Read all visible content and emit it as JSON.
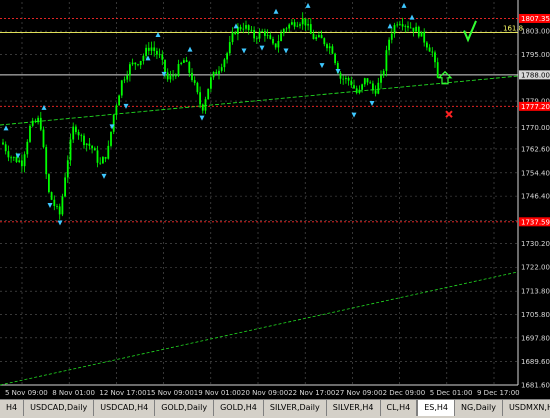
{
  "chart_data": {
    "type": "candlestick",
    "title": "",
    "x_labels": [
      "5 Nov 09:00",
      "8 Nov 01:00",
      "12 Nov 17:00",
      "15 Nov 09:00",
      "19 Nov 01:00",
      "20 Nov 09:00",
      "22 Nov 17:00",
      "27 Nov 09:00",
      "2 Dec 09:00",
      "5 Dec 01:00",
      "9 Dec 17:00"
    ],
    "y_ticks": [
      "1803.00",
      "1795.00",
      "1788.00",
      "1779.00",
      "1770.00",
      "1762.60",
      "1754.40",
      "1746.40",
      "1738.00",
      "1730.20",
      "1722.00",
      "1713.80",
      "1705.80",
      "1697.80",
      "1689.60",
      "1681.60"
    ],
    "ylim": [
      1681.6,
      1813
    ],
    "series_color": "#00ff00",
    "grid": true,
    "horizontal_levels": [
      {
        "label": "1807.35",
        "value": 1807.35,
        "color": "#ff2a2a",
        "style": "dotted",
        "badge": true
      },
      {
        "label": "161.8",
        "value": 1802.5,
        "color": "#ffff66",
        "style": "solid",
        "badge": false
      },
      {
        "label": "1788.00",
        "value": 1788.0,
        "color": "#d8d8d8",
        "style": "solid",
        "badge": true
      },
      {
        "label": "1777.20",
        "value": 1777.2,
        "color": "#ff2a2a",
        "style": "dotted",
        "badge": true
      },
      {
        "label": "1737.59",
        "value": 1737.59,
        "color": "#ff2a2a",
        "style": "dotted",
        "badge": true
      }
    ],
    "current_price": "1788.00"
  },
  "tabs": [
    {
      "label": "H4",
      "active": false
    },
    {
      "label": "USDCAD,Daily",
      "active": false
    },
    {
      "label": "USDCAD,H4",
      "active": false
    },
    {
      "label": "GOLD,Daily",
      "active": false
    },
    {
      "label": "GOLD,H4",
      "active": false
    },
    {
      "label": "SILVER,Daily",
      "active": false
    },
    {
      "label": "SILVER,H4",
      "active": false
    },
    {
      "label": "CL,H4",
      "active": false
    },
    {
      "label": "ES,H4",
      "active": true
    },
    {
      "label": "NG,Daily",
      "active": false
    },
    {
      "label": "USDMXN,H4",
      "active": false
    }
  ],
  "icons": {
    "check": "checkmark-icon",
    "arrow": "up-arrow-icon",
    "cross": "red-x-icon"
  },
  "colors": {
    "background": "#000000",
    "candle": "#00ff00",
    "grid": "#5a5a5a",
    "fractal": "#3ec8ff",
    "trend": "#22dd22"
  }
}
